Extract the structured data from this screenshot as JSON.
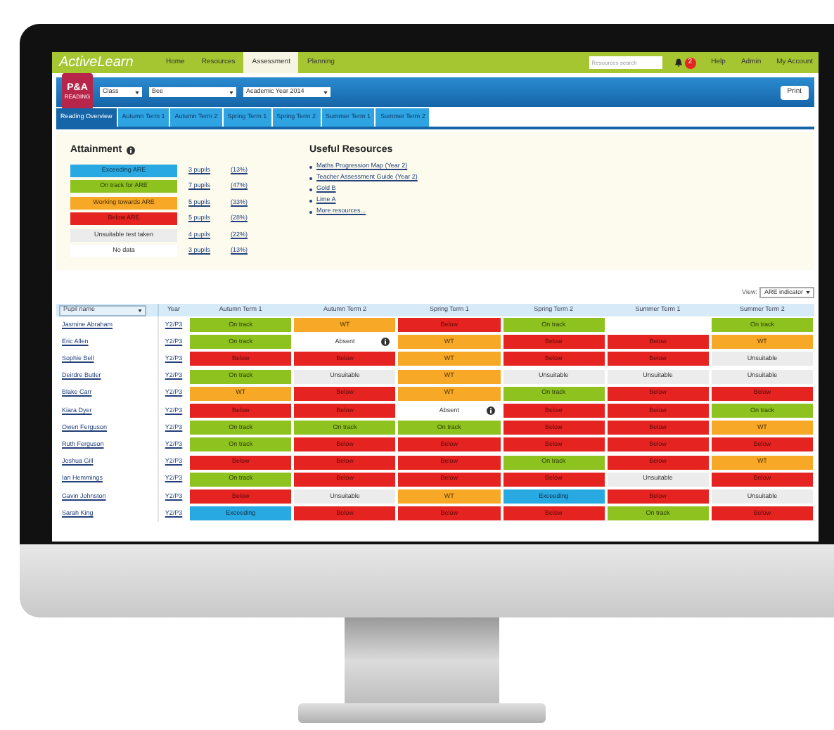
{
  "nav": {
    "brand": "ActiveLearn",
    "items": [
      {
        "label": "Home",
        "selected": false
      },
      {
        "label": "Resources",
        "selected": false
      },
      {
        "label": "Assessment",
        "selected": true
      },
      {
        "label": "Planning",
        "selected": false
      }
    ],
    "search": {
      "placeholder": "Resources search"
    },
    "notifications": "2",
    "links": [
      "Help",
      "Admin",
      "My Account"
    ]
  },
  "toolbar": {
    "logo": "P&A",
    "logo_sub": "READING",
    "selects": [
      "Class",
      "Bee",
      "Academic Year 2014"
    ],
    "print": "Print"
  },
  "tabs": [
    {
      "label": "Reading Overview",
      "selected": true
    },
    {
      "label": "Autumn Term 1",
      "selected": false
    },
    {
      "label": "Autumn Term 2",
      "selected": false
    },
    {
      "label": "Spring Term 1",
      "selected": false
    },
    {
      "label": "Spring Term 2",
      "selected": false
    },
    {
      "label": "Summer Term 1",
      "selected": false
    },
    {
      "label": "Summer Term 2",
      "selected": false
    }
  ],
  "attainment": {
    "title": "Attainment",
    "rows": [
      {
        "label": "Exceeding ARE",
        "kind": "exceeding",
        "pupils": "3 pupils",
        "percent": "(13%)"
      },
      {
        "label": "On track for ARE",
        "kind": "on_track",
        "pupils": "7 pupils",
        "percent": "(47%)"
      },
      {
        "label": "Working towards ARE",
        "kind": "wt",
        "pupils": "5 pupils",
        "percent": "(33%)"
      },
      {
        "label": "Below ARE",
        "kind": "below",
        "pupils": "5 pupils",
        "percent": "(28%)"
      },
      {
        "label": "Unsuitable test taken",
        "kind": "unsuitable",
        "pupils": "4 pupils",
        "percent": "(22%)"
      },
      {
        "label": "No data",
        "kind": "none",
        "pupils": "3 pupils",
        "percent": "(13%)"
      }
    ]
  },
  "resources": {
    "title": "Useful Resources",
    "links": [
      "Maths Progression Map (Year 2)",
      "Teacher Assessment Guide (Year 2)",
      "Gold B",
      "Lime A",
      "More resources..."
    ]
  },
  "view": {
    "label": "View:",
    "value": "ARE indicator"
  },
  "table": {
    "columns": [
      "Pupil name",
      "Year",
      "Autumn Term 1",
      "Autumn Term 2",
      "Spring Term 1",
      "Spring Term 2",
      "Summer Term 1",
      "Summer Term 2"
    ],
    "rows": [
      {
        "cells": [
          {
            "kind": "name",
            "text": "Jasmine Abraham"
          },
          {
            "kind": "year",
            "text": "Y2/P3"
          },
          {
            "kind": "on_track",
            "text": "On track"
          },
          {
            "kind": "wt",
            "text": "WT"
          },
          {
            "kind": "below",
            "text": "Below"
          },
          {
            "kind": "on_track",
            "text": "On track"
          },
          {
            "kind": "blank"
          },
          {
            "kind": "on_track",
            "text": "On track"
          }
        ]
      },
      {
        "cells": [
          {
            "kind": "name",
            "text": "Eric Allen"
          },
          {
            "kind": "year",
            "text": "Y2/P3"
          },
          {
            "kind": "on_track",
            "text": "On track"
          },
          {
            "kind": "absent",
            "text": "Absent"
          },
          {
            "kind": "wt",
            "text": "WT"
          },
          {
            "kind": "below",
            "text": "Below"
          },
          {
            "kind": "below",
            "text": "Below"
          },
          {
            "kind": "wt",
            "text": "WT"
          }
        ]
      },
      {
        "cells": [
          {
            "kind": "name",
            "text": "Sophie Bell"
          },
          {
            "kind": "year",
            "text": "Y2/P3"
          },
          {
            "kind": "below",
            "text": "Below"
          },
          {
            "kind": "below",
            "text": "Below"
          },
          {
            "kind": "wt",
            "text": "WT"
          },
          {
            "kind": "below",
            "text": "Below"
          },
          {
            "kind": "below",
            "text": "Below"
          },
          {
            "kind": "unsuitable",
            "text": "Unsuitable"
          }
        ]
      },
      {
        "cells": [
          {
            "kind": "name",
            "text": "Deirdre Butler"
          },
          {
            "kind": "year",
            "text": "Y2/P3"
          },
          {
            "kind": "on_track",
            "text": "On track"
          },
          {
            "kind": "unsuitable",
            "text": "Unsuitable"
          },
          {
            "kind": "wt",
            "text": "WT"
          },
          {
            "kind": "unsuitable",
            "text": "Unsuitable"
          },
          {
            "kind": "unsuitable",
            "text": "Unsuitable"
          },
          {
            "kind": "unsuitable",
            "text": "Unsuitable"
          }
        ]
      },
      {
        "cells": [
          {
            "kind": "name",
            "text": "Blake Carr"
          },
          {
            "kind": "year",
            "text": "Y2/P3"
          },
          {
            "kind": "wt",
            "text": "WT"
          },
          {
            "kind": "below",
            "text": "Below"
          },
          {
            "kind": "wt",
            "text": "WT"
          },
          {
            "kind": "on_track",
            "text": "On track"
          },
          {
            "kind": "below",
            "text": "Below"
          },
          {
            "kind": "below",
            "text": "Below"
          }
        ]
      },
      {
        "cells": [
          {
            "kind": "name",
            "text": "Kiara Dyer"
          },
          {
            "kind": "year",
            "text": "Y2/P3"
          },
          {
            "kind": "below",
            "text": "Below"
          },
          {
            "kind": "below",
            "text": "Below"
          },
          {
            "kind": "absent",
            "text": "Absent"
          },
          {
            "kind": "below",
            "text": "Below"
          },
          {
            "kind": "below",
            "text": "Below"
          },
          {
            "kind": "on_track",
            "text": "On track"
          }
        ]
      },
      {
        "cells": [
          {
            "kind": "name",
            "text": "Owen Ferguson"
          },
          {
            "kind": "year",
            "text": "Y2/P3"
          },
          {
            "kind": "on_track",
            "text": "On track"
          },
          {
            "kind": "on_track",
            "text": "On track"
          },
          {
            "kind": "on_track",
            "text": "On track"
          },
          {
            "kind": "below",
            "text": "Below"
          },
          {
            "kind": "below",
            "text": "Below"
          },
          {
            "kind": "wt",
            "text": "WT"
          }
        ]
      },
      {
        "cells": [
          {
            "kind": "name",
            "text": "Ruth Ferguson"
          },
          {
            "kind": "year",
            "text": "Y2/P3"
          },
          {
            "kind": "on_track",
            "text": "On track"
          },
          {
            "kind": "below",
            "text": "Below"
          },
          {
            "kind": "below",
            "text": "Below"
          },
          {
            "kind": "below",
            "text": "Below"
          },
          {
            "kind": "below",
            "text": "Below"
          },
          {
            "kind": "below",
            "text": "Below"
          }
        ]
      },
      {
        "cells": [
          {
            "kind": "name",
            "text": "Joshua Gill"
          },
          {
            "kind": "year",
            "text": "Y2/P3"
          },
          {
            "kind": "below",
            "text": "Below"
          },
          {
            "kind": "below",
            "text": "Below"
          },
          {
            "kind": "below",
            "text": "Below"
          },
          {
            "kind": "on_track",
            "text": "On track"
          },
          {
            "kind": "below",
            "text": "Below"
          },
          {
            "kind": "wt",
            "text": "WT"
          }
        ]
      },
      {
        "cells": [
          {
            "kind": "name",
            "text": "Ian Hemmings"
          },
          {
            "kind": "year",
            "text": "Y2/P3"
          },
          {
            "kind": "on_track",
            "text": "On track"
          },
          {
            "kind": "below",
            "text": "Below"
          },
          {
            "kind": "below",
            "text": "Below"
          },
          {
            "kind": "below",
            "text": "Below"
          },
          {
            "kind": "unsuitable",
            "text": "Unsuitable"
          },
          {
            "kind": "below",
            "text": "Below"
          }
        ]
      },
      {
        "cells": [
          {
            "kind": "name",
            "text": "Gavin Johnston"
          },
          {
            "kind": "year",
            "text": "Y2/P3"
          },
          {
            "kind": "below",
            "text": "Below"
          },
          {
            "kind": "unsuitable",
            "text": "Unsuitable"
          },
          {
            "kind": "wt",
            "text": "WT"
          },
          {
            "kind": "exceeding",
            "text": "Exceeding"
          },
          {
            "kind": "below",
            "text": "Below"
          },
          {
            "kind": "unsuitable",
            "text": "Unsuitable"
          }
        ]
      },
      {
        "cells": [
          {
            "kind": "name",
            "text": "Sarah King"
          },
          {
            "kind": "year",
            "text": "Y2/P3"
          },
          {
            "kind": "exceeding",
            "text": "Exceeding"
          },
          {
            "kind": "below",
            "text": "Below"
          },
          {
            "kind": "below",
            "text": "Below"
          },
          {
            "kind": "below",
            "text": "Below"
          },
          {
            "kind": "on_track",
            "text": "On track"
          },
          {
            "kind": "below",
            "text": "Below"
          }
        ]
      }
    ]
  }
}
